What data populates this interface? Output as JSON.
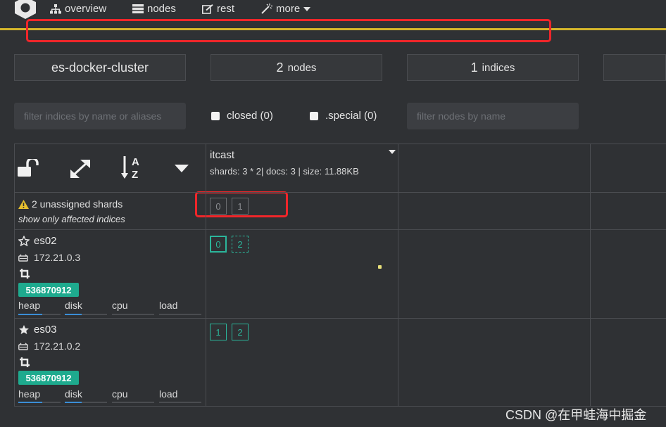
{
  "nav": {
    "overview": "overview",
    "nodes": "nodes",
    "rest": "rest",
    "more": "more"
  },
  "summary": {
    "cluster_name": "es-docker-cluster",
    "nodes_count": "2",
    "nodes_label": "nodes",
    "indices_count": "1",
    "indices_label": "indices"
  },
  "filters": {
    "indices_placeholder": "filter indices by name or aliases",
    "closed_label": "closed (0)",
    "special_label": ".special (0)",
    "nodes_placeholder": "filter nodes by name"
  },
  "index": {
    "name": "itcast",
    "stats": "shards: 3 * 2| docs: 3 | size: 11.88KB"
  },
  "unassigned": {
    "text": "2 unassigned shards",
    "link": "show only affected indices",
    "shards": [
      "0",
      "1"
    ]
  },
  "nodes": [
    {
      "name": "es02",
      "ip": "172.21.0.3",
      "badge": "536870912",
      "shards": [
        {
          "label": "0",
          "kind": "primary"
        },
        {
          "label": "2",
          "kind": "replica"
        }
      ],
      "metrics": {
        "heap": "heap",
        "disk": "disk",
        "cpu": "cpu",
        "load": "load"
      }
    },
    {
      "name": "es03",
      "ip": "172.21.0.2",
      "badge": "536870912",
      "shards": [
        {
          "label": "1",
          "kind": "replica-solid"
        },
        {
          "label": "2",
          "kind": "replica-solid"
        }
      ],
      "metrics": {
        "heap": "heap",
        "disk": "disk",
        "cpu": "cpu",
        "load": "load"
      }
    }
  ],
  "colors": {
    "background": "#2f3134",
    "accent_green": "#2bb69b",
    "badge_green": "#1eaa8e",
    "cluster_status": "#d4b52b",
    "annotation_red": "#f0262a"
  },
  "icons": {
    "logo": "hexagon-logo-icon",
    "overview": "sitemap-icon",
    "nodes": "server-list-icon",
    "rest": "edit-icon",
    "more": "wand-icon",
    "lock": "unlock-icon",
    "expand": "expand-icon",
    "sort": "sort-alpha-icon",
    "dropdown": "caret-down-icon",
    "warning": "warning-icon",
    "master_star_outline": "star-outline-icon",
    "master_star_filled": "star-filled-icon",
    "drive": "hdd-icon",
    "crop": "crop-icon"
  },
  "watermark": "CSDN @在甲蛙海中掘金"
}
